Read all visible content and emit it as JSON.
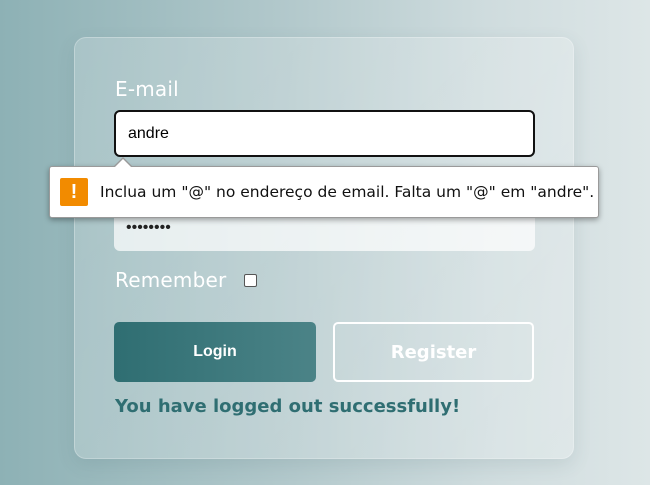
{
  "form": {
    "email_label": "E-mail",
    "email_value": "andre",
    "password_value": "••••••••",
    "remember_label": "Remember",
    "remember_checked": false,
    "login_label": "Login",
    "register_label": "Register",
    "status_message": "You have logged out successfully!"
  },
  "validation": {
    "icon": "warning-icon",
    "icon_glyph": "!",
    "message": "Inclua um \"@\" no endereço de email. Falta um \"@\" em \"andre\"."
  },
  "colors": {
    "accent": "#2f6e72",
    "warning": "#f28b00"
  }
}
